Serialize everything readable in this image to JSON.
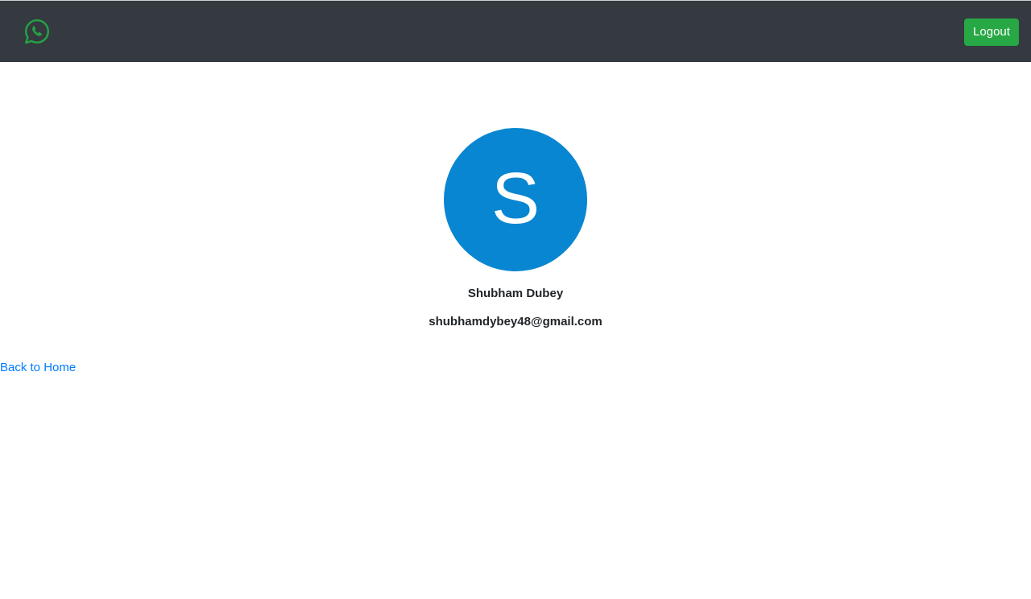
{
  "navbar": {
    "logo_icon": "whatsapp-icon",
    "logout_label": "Logout",
    "background_color": "#343a40",
    "logout_color": "#28a745",
    "logo_color": "#25a244"
  },
  "profile": {
    "avatar_initial": "S",
    "avatar_color": "#0886d1",
    "name": "Shubham Dubey",
    "email": "shubhamdybey48@gmail.com"
  },
  "links": {
    "back_home": "Back to Home",
    "link_color": "#007bff"
  }
}
